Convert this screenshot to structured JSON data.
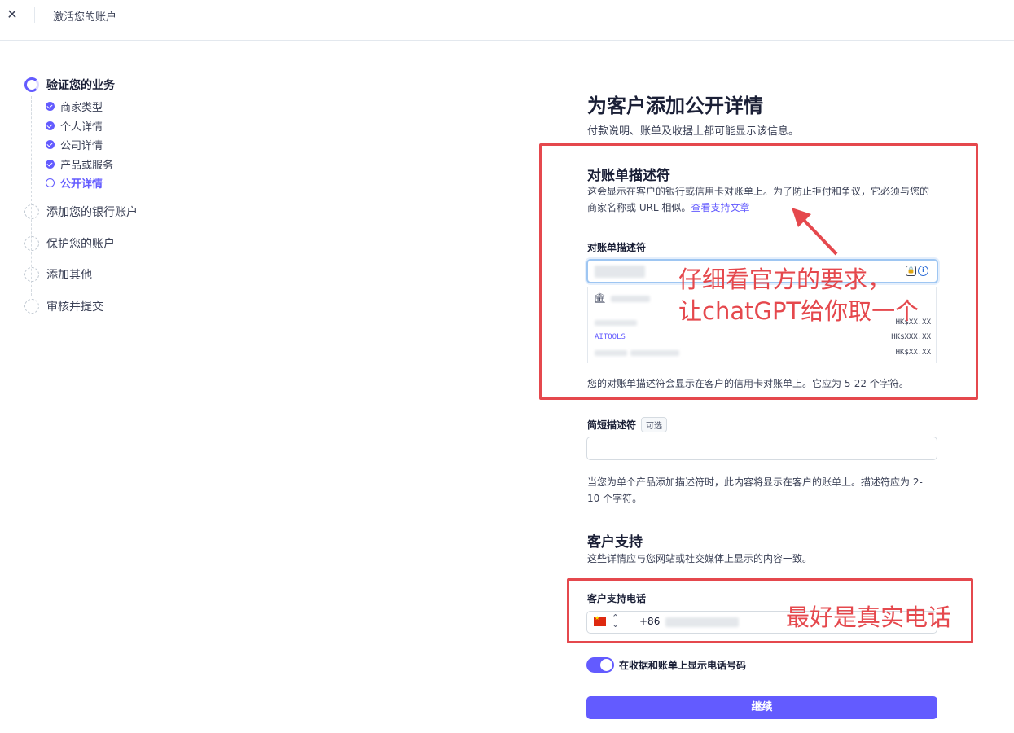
{
  "topbar": {
    "close_label": "✕",
    "title": "激活您的账户"
  },
  "sidebar": {
    "steps": [
      {
        "label": "验证您的业务",
        "state": "active"
      },
      {
        "label": "添加您的银行账户",
        "state": "todo"
      },
      {
        "label": "保护您的账户",
        "state": "todo"
      },
      {
        "label": "添加其他",
        "state": "todo"
      },
      {
        "label": "审核并提交",
        "state": "todo"
      }
    ],
    "substeps": [
      {
        "label": "商家类型",
        "state": "done"
      },
      {
        "label": "个人详情",
        "state": "done"
      },
      {
        "label": "公司详情",
        "state": "done"
      },
      {
        "label": "产品或服务",
        "state": "done"
      },
      {
        "label": "公开详情",
        "state": "current"
      }
    ]
  },
  "main": {
    "title": "为客户添加公开详情",
    "subtitle": "付款说明、账单及收据上都可能显示该信息。",
    "descriptor": {
      "heading": "对账单描述符",
      "text": "这会显示在客户的银行或信用卡对账单上。为了防止拒付和争议，它必须与您的商家名称或 URL 相似。",
      "link": "查看支持文章",
      "field_label": "对账单描述符",
      "receipt": {
        "rows": [
          {
            "name": "",
            "amount": "HK$XX.XX"
          },
          {
            "name": "AITOOLS",
            "amount": "HK$XXX.XX"
          },
          {
            "name": "",
            "amount": "HK$XX.XX"
          }
        ]
      },
      "help": "您的对账单描述符会显示在客户的信用卡对账单上。它应为 5-22 个字符。"
    },
    "short_descriptor": {
      "label": "简短描述符",
      "badge": "可选",
      "value": "",
      "help": "当您为单个产品添加描述符时，此内容将显示在客户的账单上。描述符应为 2-10 个字符。"
    },
    "support": {
      "heading": "客户支持",
      "text": "这些详情应与您网站或社交媒体上显示的内容一致。",
      "phone_label": "客户支持电话",
      "country_code": "+86",
      "toggle_label": "在收据和账单上显示电话号码",
      "toggle_on": true
    },
    "continue_label": "继续"
  },
  "annotations": {
    "line1": "仔细看官方的要求，",
    "line2": "让chatGPT给你取一个",
    "phone_note": "最好是真实电话",
    "color": "#e5484d"
  }
}
